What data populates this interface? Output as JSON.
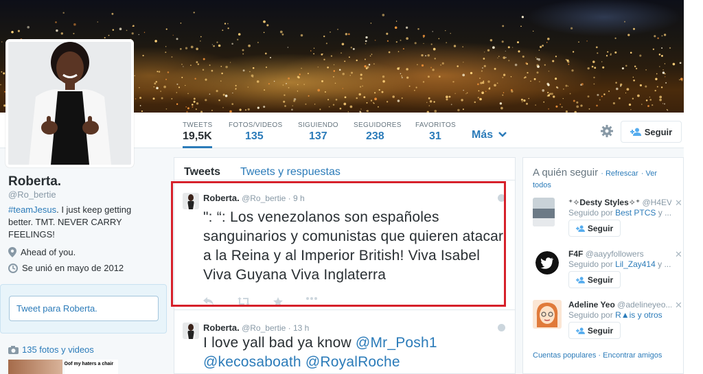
{
  "profile": {
    "name": "Roberta.",
    "handle": "@Ro_bertie",
    "bio_hashtag": "#teamJesus",
    "bio_text": ". I just keep getting better. TMT. NEVER CARRY FEELINGS!",
    "location": "Ahead of you.",
    "joined": "Se unió en mayo de 2012",
    "tweet_to_placeholder": "Tweet para Roberta.",
    "photos_link": "135 fotos y videos"
  },
  "stats": [
    {
      "label": "TWEETS",
      "value": "19,5K"
    },
    {
      "label": "FOTOS/VIDEOS",
      "value": "135"
    },
    {
      "label": "SIGUIENDO",
      "value": "137"
    },
    {
      "label": "SEGUIDORES",
      "value": "238"
    },
    {
      "label": "FAVORITOS",
      "value": "31"
    }
  ],
  "nav": {
    "more_label": "Más",
    "follow_label": "Seguir"
  },
  "timeline": {
    "tabs": [
      "Tweets",
      "Tweets y respuestas"
    ],
    "tweets": [
      {
        "name": "Roberta.",
        "handle": "@Ro_bertie",
        "time": "· 9 h",
        "text": "\": “: Los venezolanos son españoles sanguinarios y comunistas que quieren atacar a la Reina y al Imperior British! Viva Isabel Viva Guyana Viva Inglaterra"
      },
      {
        "name": "Roberta.",
        "handle": "@Ro_bertie",
        "time": "· 13 h",
        "text_plain": "I love yall bad ya know ",
        "mention1": "@Mr_Posh1",
        "mention2": "@kecosaboath",
        "mention3": "@RoyalRoche"
      }
    ]
  },
  "who_to_follow": {
    "title": "A quién seguir",
    "refresh": "· Refrescar",
    "view_all": "· Ver todos",
    "follow_label": "Seguir",
    "items": [
      {
        "name": "⁺✧Desty Styles✧⁺",
        "handle": "@H4EV...",
        "by_prefix": "Seguido por ",
        "by": "Best PTCS",
        "by_suffix": " y ..."
      },
      {
        "name": "F4F",
        "handle": "@aayyfollowers",
        "by_prefix": "Seguido por ",
        "by": "Lil_Zay414",
        "by_suffix": " y ..."
      },
      {
        "name": "Adeline Yeo",
        "handle": "@adelineyeo...",
        "by_prefix": "Seguido por ",
        "by": "R▲is",
        "by_suffix": " y otros"
      }
    ],
    "footer": "Cuentas populares · Encontrar amigos"
  },
  "thumb_caption": "Oof my haters a chair",
  "colors": {
    "accent": "#2b7bb9",
    "highlight": "#d6202a"
  }
}
